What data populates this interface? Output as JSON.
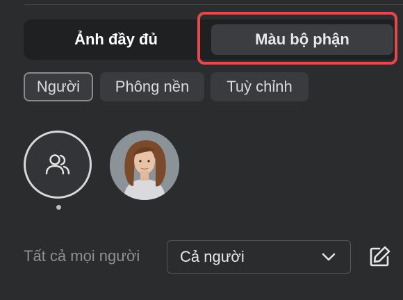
{
  "tabs": {
    "full_image": "Ảnh đầy đủ",
    "part_color": "Màu bộ phận"
  },
  "chips": [
    "Người",
    "Phông nền",
    "Tuỳ chỉnh"
  ],
  "avatars": {
    "group_icon": "people-icon",
    "photo_icon": "person-photo"
  },
  "scope": {
    "label": "Tất cả mọi người",
    "selected": "Cả người"
  },
  "colors": {
    "highlight": "#e5484d",
    "background": "#2b2c2e"
  }
}
